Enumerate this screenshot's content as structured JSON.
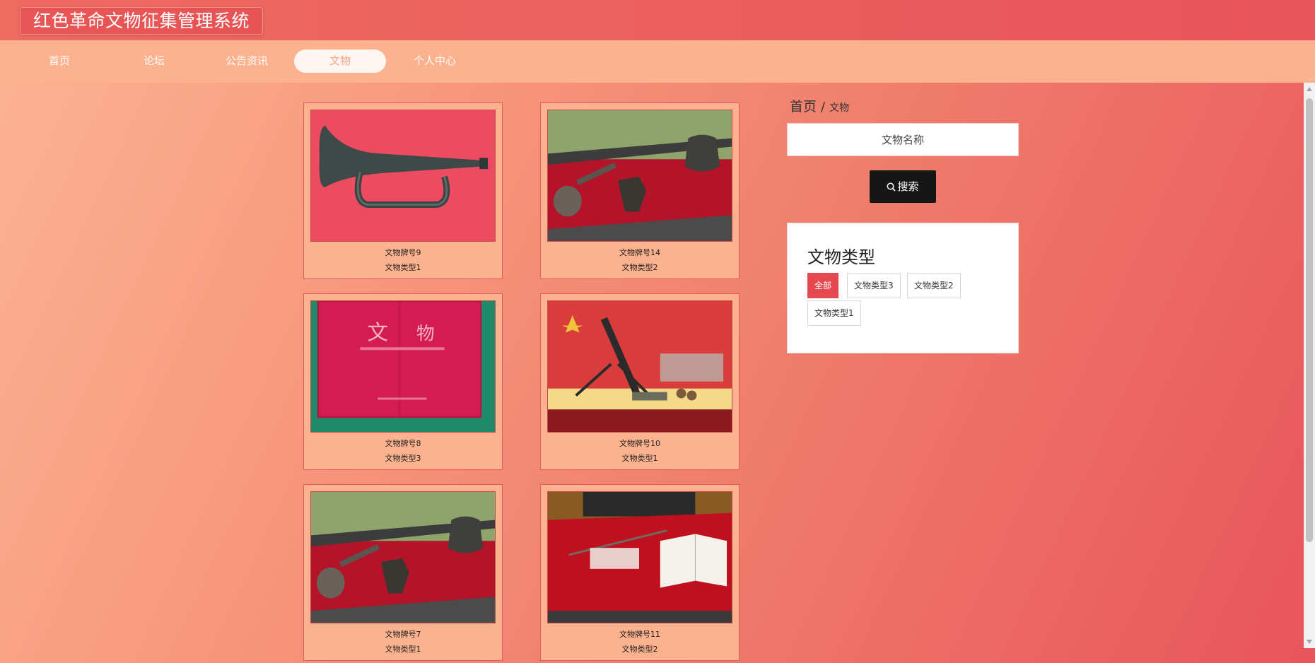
{
  "app": {
    "title": "红色革命文物征集管理系统"
  },
  "nav": {
    "items": [
      {
        "label": "首页"
      },
      {
        "label": "论坛"
      },
      {
        "label": "公告资讯"
      },
      {
        "label": "文物",
        "active": true
      },
      {
        "label": "个人中心"
      }
    ]
  },
  "breadcrumb": {
    "home": "首页",
    "separator": "/",
    "current": "文物"
  },
  "search": {
    "placeholder": "文物名称",
    "value": "",
    "button_label": "搜索"
  },
  "category": {
    "title": "文物类型",
    "tags": [
      {
        "label": "全部",
        "active": true
      },
      {
        "label": "文物类型3"
      },
      {
        "label": "文物类型2"
      },
      {
        "label": "文物类型1"
      }
    ]
  },
  "relics": [
    {
      "name": "文物牌号9",
      "type": "文物类型1",
      "image": "bugle"
    },
    {
      "name": "文物牌号14",
      "type": "文物类型2",
      "image": "display-case-tools"
    },
    {
      "name": "文物牌号8",
      "type": "文物类型3",
      "image": "magazine-cover"
    },
    {
      "name": "文物牌号10",
      "type": "文物类型1",
      "image": "mortar-exhibit"
    },
    {
      "name": "文物牌号7",
      "type": "文物类型1",
      "image": "display-case-tools"
    },
    {
      "name": "文物牌号11",
      "type": "文物类型2",
      "image": "book-and-sword"
    }
  ],
  "colors": {
    "topbar": "#e9535a",
    "navbar": "#fdb28f",
    "accent": "#e5484e",
    "search_button": "#161616"
  }
}
